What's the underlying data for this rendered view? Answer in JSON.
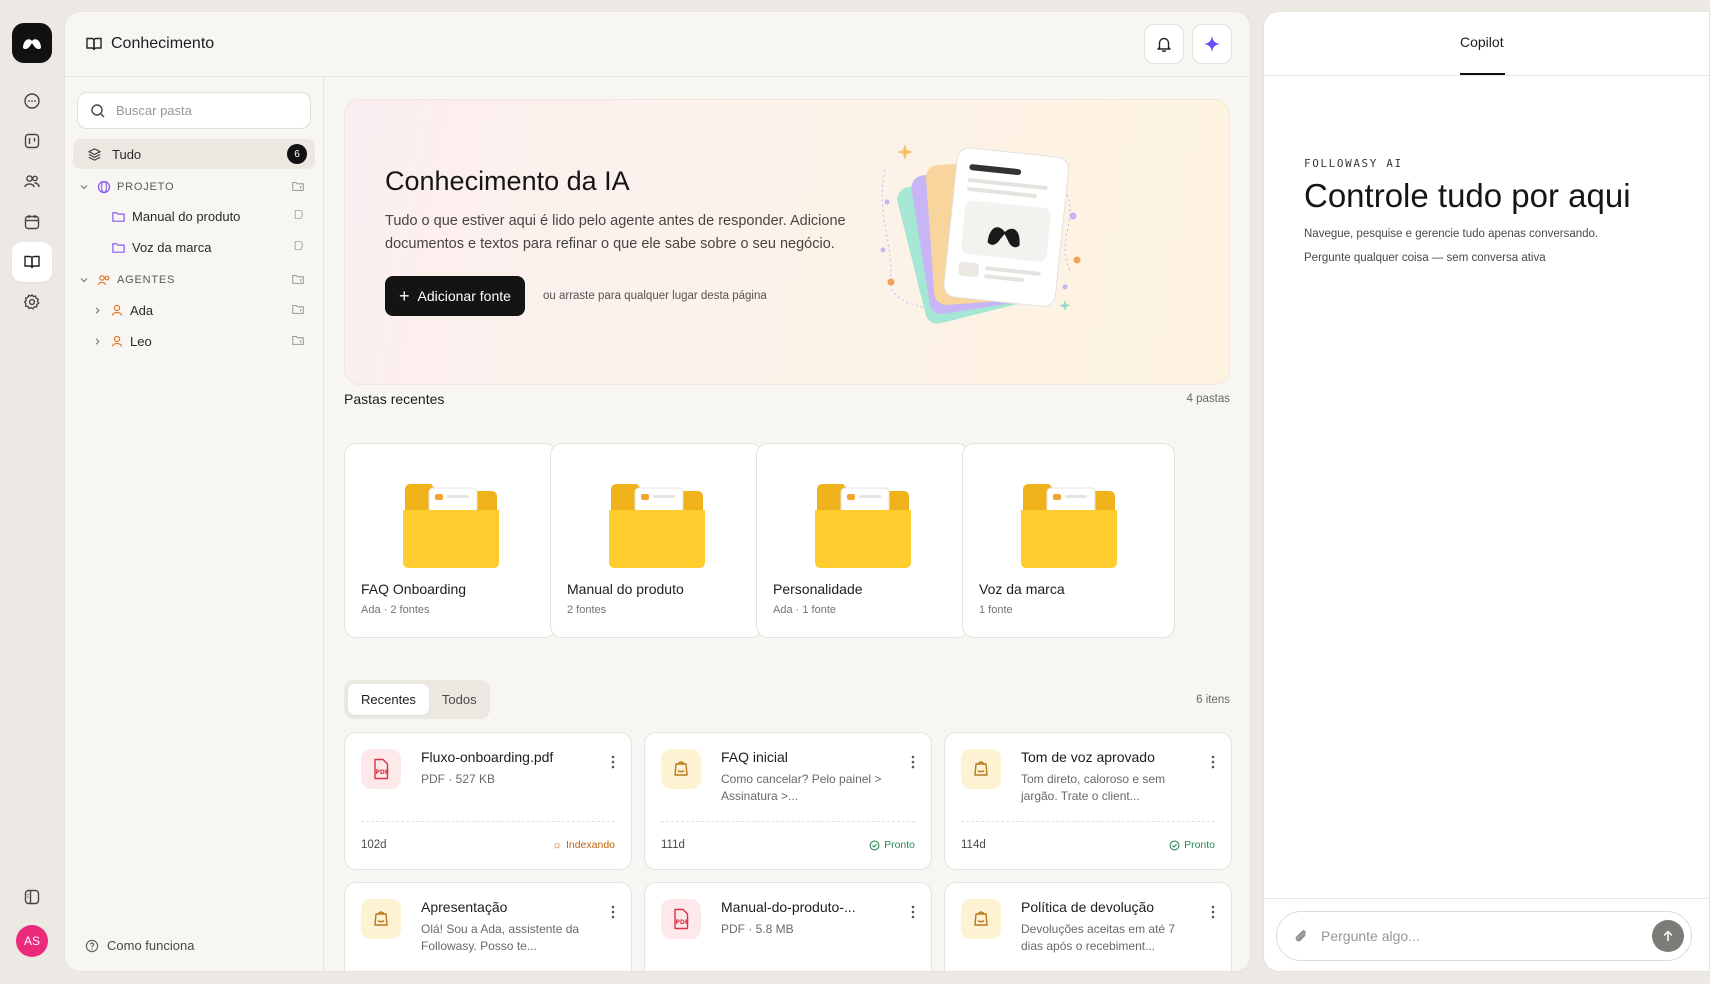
{
  "app": {
    "avatar_initials": "AS",
    "accent": "#111111",
    "avatar_color": "#ec2a7b"
  },
  "header": {
    "title": "Conhecimento"
  },
  "sidebar": {
    "search_placeholder": "Buscar pasta",
    "all_label": "Tudo",
    "all_count": "6",
    "sections": [
      {
        "label": "PROJETO",
        "items": [
          "Manual do produto",
          "Voz da marca"
        ]
      },
      {
        "label": "AGENTES",
        "items": [
          "Ada",
          "Leo"
        ]
      }
    ],
    "how_it_works": "Como funciona"
  },
  "hero": {
    "title": "Conhecimento da IA",
    "description": "Tudo o que estiver aqui é lido pelo agente antes de responder. Adicione documentos e textos para refinar o que ele sabe sobre o seu negócio.",
    "add_button": "Adicionar fonte",
    "hint": "ou arraste para qualquer lugar desta página"
  },
  "recent_folders": {
    "title": "Pastas recentes",
    "meta": "4 pastas",
    "items": [
      {
        "name": "FAQ Onboarding",
        "meta": "Ada · 2 fontes"
      },
      {
        "name": "Manual do produto",
        "meta": "2 fontes"
      },
      {
        "name": "Personalidade",
        "meta": "Ada · 1 fonte"
      },
      {
        "name": "Voz da marca",
        "meta": "1 fonte"
      }
    ]
  },
  "tabs": {
    "recent": "Recentes",
    "all": "Todos",
    "meta": "6 itens"
  },
  "documents": [
    {
      "title": "Fluxo-onboarding.pdf",
      "sub": "PDF · 527 KB",
      "age": "102d",
      "status": "Indexando",
      "kind": "pdf"
    },
    {
      "title": "FAQ inicial",
      "sub": "Como cancelar? Pelo painel > Assinatura >...",
      "age": "111d",
      "status": "Pronto",
      "kind": "txt"
    },
    {
      "title": "Tom de voz aprovado",
      "sub": "Tom direto, caloroso e sem jargão. Trate o client...",
      "age": "114d",
      "status": "Pronto",
      "kind": "txt"
    },
    {
      "title": "Apresentação",
      "sub": "Olá! Sou a Ada, assistente da Followasy. Posso te...",
      "age": "",
      "status": "",
      "kind": "txt"
    },
    {
      "title": "Manual-do-produto-...",
      "sub": "PDF · 5.8 MB",
      "age": "",
      "status": "",
      "kind": "pdf"
    },
    {
      "title": "Política de devolução",
      "sub": "Devoluções aceitas em até 7 dias após o recebiment...",
      "age": "",
      "status": "",
      "kind": "txt"
    }
  ],
  "copilot": {
    "tab": "Copilot",
    "brand": "FOLLOWASY AI",
    "title": "Controle tudo por aqui",
    "sub1": "Navegue, pesquise e gerencie tudo apenas conversando.",
    "sub2": "Pergunte qualquer coisa — sem conversa ativa",
    "input_placeholder": "Pergunte algo..."
  }
}
